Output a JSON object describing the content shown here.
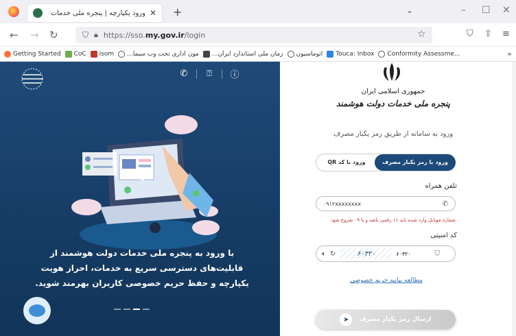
{
  "browser": {
    "tab_title": "ورود یکپارچه | پنجره ملی خدمات",
    "tab_close": "✕",
    "new_tab": "+",
    "url_prefix": "https://sso.",
    "url_domain": "my.gov.ir",
    "url_path": "/login",
    "window_controls": [
      "–",
      "☐",
      "✕"
    ]
  },
  "bookmarks": [
    {
      "label": "Getting Started",
      "color": "#ff7139"
    },
    {
      "label": "CoC",
      "color": "#6ab04c"
    },
    {
      "label": "isom",
      "color": "#c0392b"
    },
    {
      "label": "...مون اداری تحت وب سیما",
      "color": "#555555"
    },
    {
      "label": "...زمان ملی استاندارد ایران",
      "color": "#444444"
    },
    {
      "label": "اتوماسیون",
      "color": "#555555"
    },
    {
      "label": "Touca: Inbox",
      "color": "#2e86de"
    },
    {
      "label": "Conformity Assessme...",
      "color": "#555555"
    }
  ],
  "left_panel": {
    "icons": [
      "phone-icon",
      "help-icon",
      "info-icon"
    ],
    "promo_lines": [
      "با ورود به پنجره ملی خدمات دولت هوشمند از",
      "قابلیت‌های دسترسی سریع به خدمات، احراز هویت",
      "یکپارچه و حفظ حریم خصوصی کاربران بهرمند شوید."
    ]
  },
  "right_panel": {
    "gov_line1": "جمهوری اسلامی ایران",
    "gov_line2": "پنجره ملی خدمات دولت هوشمند",
    "subtitle": "ورود به سامانه از طریق رمز یکبار مصرف",
    "tab_otp": "ورود با رمز یکبار مصرف",
    "tab_qr": "ورود با کد QR",
    "phone_label": "تلفن همراه",
    "phone_value": "۰۹۱۲xxxxxxxx",
    "phone_hint": "شماره موبایل وارد شده باید ۱۱ رقمی باشد و با ۰۹ شروع شود",
    "captcha_label": "کد امنیتی",
    "captcha_text": "۶۰۳۲۰",
    "captcha_input": "۶۰۳۲۰",
    "privacy_link": "مطالعه بیانیه حریم خصوصی",
    "submit_label": "ارسال رمز یکبار مصرف"
  }
}
